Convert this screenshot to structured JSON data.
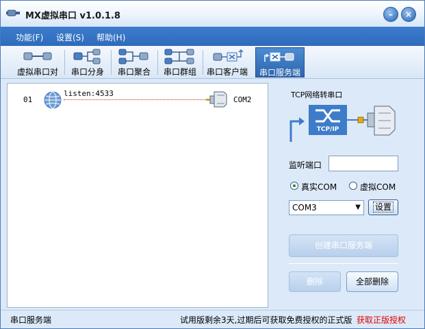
{
  "window": {
    "title": "MX虚拟串口  v1.0.1.8",
    "minimize_glyph": "–",
    "close_glyph": "×"
  },
  "menu": [
    "功能(F)",
    "设置(S)",
    "帮助(H)"
  ],
  "toolbar": {
    "items": [
      "虚拟串口对",
      "串口分身",
      "串口聚合",
      "串口群组",
      "串口客户端",
      "串口服务端"
    ],
    "active": "串口服务端"
  },
  "list": {
    "rows": [
      {
        "index": "01",
        "listen": "listen:4533",
        "com": "COM2"
      }
    ]
  },
  "panel": {
    "title": "TCP网络转串口",
    "diagram_label": "TCP/IP",
    "port_label": "监听端口",
    "port_value": "",
    "radio_real": "真实COM",
    "radio_virtual": "虚拟COM",
    "radio_selected": "真实COM",
    "com_selected": "COM3",
    "dropdown_glyph": "▼",
    "set_label": "设置",
    "create_label": "创建串口服务端",
    "delete_label": "删除",
    "delete_all_label": "全部删除"
  },
  "status": {
    "left": "串口服务端",
    "trial": "试用版剩余3天,过期后可获取免费授权的正式版",
    "link": "获取正版授权"
  },
  "colors": {
    "menu_bar": "#3473c4",
    "accent": "#2d65ae",
    "link": "#e00000"
  }
}
